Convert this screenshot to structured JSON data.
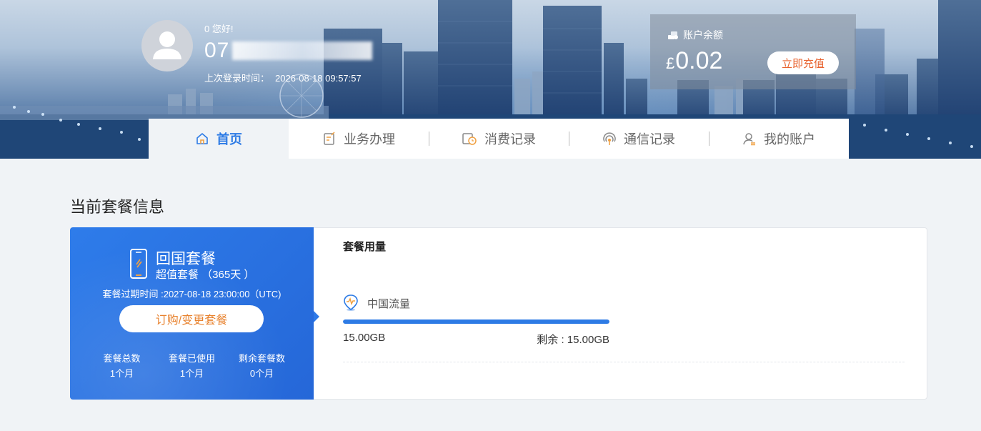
{
  "header": {
    "greeting": "0 您好!",
    "phone_prefix": "07",
    "last_login_label": "上次登录时间：",
    "last_login_value": "2026-08-18 09:57:57",
    "balance_label": "账户余额",
    "balance_currency": "£",
    "balance_value": "0.02",
    "recharge_label": "立即充值"
  },
  "nav": {
    "items": [
      {
        "label": "首页",
        "icon": "home-icon",
        "active": true
      },
      {
        "label": "业务办理",
        "icon": "service-icon"
      },
      {
        "label": "消费记录",
        "icon": "billing-clock-icon"
      },
      {
        "label": "通信记录",
        "icon": "signal-icon"
      },
      {
        "label": "我的账户",
        "icon": "user-account-icon"
      }
    ]
  },
  "main": {
    "section_title": "当前套餐信息",
    "package": {
      "name": "回国套餐",
      "subtitle": "超值套餐 （365天 ）",
      "expire": "套餐过期时间 :2027-08-18 23:00:00（UTC)",
      "change_button": "订购/变更套餐",
      "stats": [
        {
          "label": "套餐总数",
          "value": "1个月"
        },
        {
          "label": "套餐已使用",
          "value": "1个月"
        },
        {
          "label": "剩余套餐数",
          "value": "0个月"
        }
      ]
    },
    "usage": {
      "title": "套餐用量",
      "item_name": "中国流量",
      "total": "15.00GB",
      "remaining": "剩余 : 15.00GB",
      "remaining_fraction": 1.0
    }
  },
  "colors": {
    "accent": "#2d7be5",
    "recharge_text": "#e8622e",
    "package_button_text": "#e8822e"
  }
}
